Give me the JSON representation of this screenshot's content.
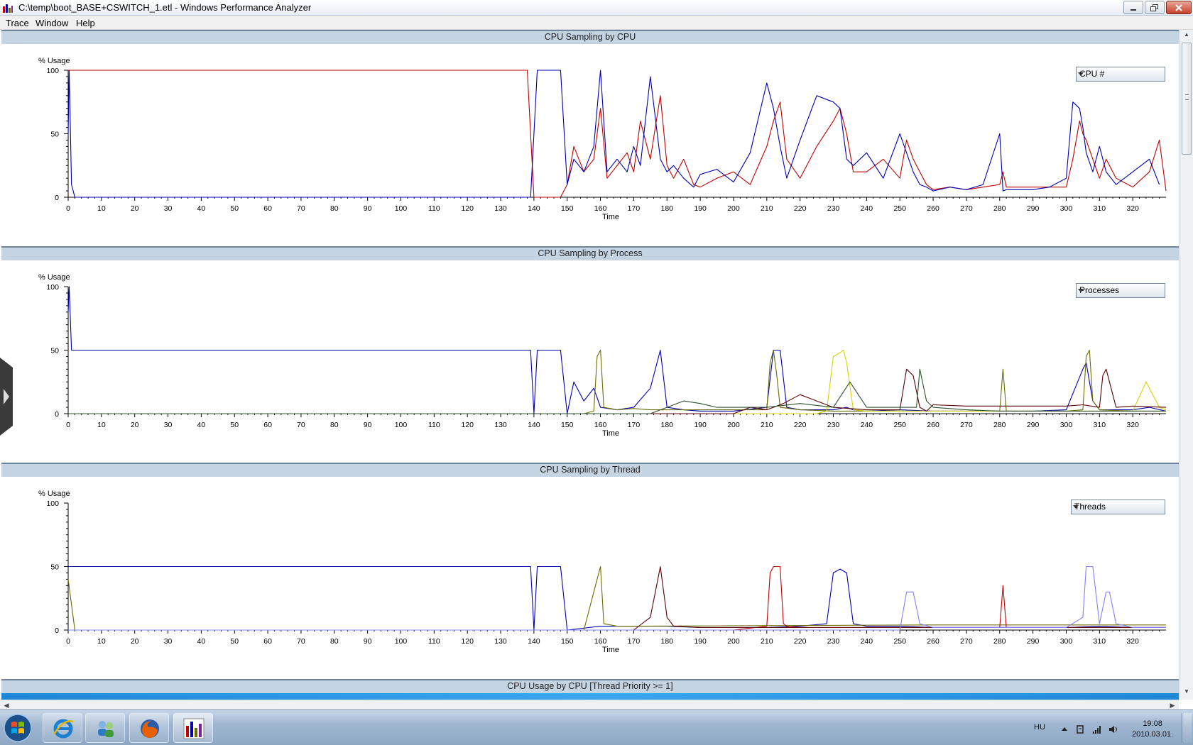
{
  "window": {
    "title": "C:\\temp\\boot_BASE+CSWITCH_1.etl - Windows Performance Analyzer"
  },
  "menu": [
    "Trace",
    "Window",
    "Help"
  ],
  "panels": [
    {
      "title": "CPU Sampling by CPU",
      "dropdown": "CPU #",
      "chart_data": {
        "type": "line",
        "ylabel": "% Usage",
        "xlabel": "Time",
        "ylim": [
          0,
          100
        ],
        "xlim": [
          0,
          330
        ],
        "yticks": [
          "100",
          "50",
          "0"
        ],
        "xticks": [
          "0",
          "10",
          "20",
          "30",
          "40",
          "50",
          "60",
          "70",
          "80",
          "90",
          "100",
          "110",
          "120",
          "130",
          "140",
          "150",
          "160",
          "170",
          "180",
          "190",
          "200",
          "210",
          "220",
          "230",
          "240",
          "250",
          "260",
          "270",
          "280",
          "290",
          "300",
          "310",
          "320"
        ],
        "colors": [
          "#c00000",
          "#0000b0"
        ],
        "series": [
          {
            "x": [
              0,
              0.3,
              1,
              138,
              139,
              140,
              141,
              148,
              150,
              152,
              155,
              158,
              160,
              162,
              165,
              168,
              170,
              172,
              175,
              178,
              180,
              182,
              185,
              188,
              190,
              195,
              200,
              205,
              210,
              212,
              214,
              216,
              220,
              225,
              230,
              232,
              234,
              236,
              240,
              245,
              250,
              252,
              254,
              256,
              258,
              260,
              265,
              270,
              275,
              280,
              281,
              282,
              285,
              290,
              295,
              300,
              302,
              304,
              305,
              306,
              308,
              310,
              312,
              315,
              320,
              325,
              328,
              330
            ],
            "y": [
              100,
              100,
              100,
              100,
              50,
              0,
              0,
              0,
              10,
              40,
              20,
              30,
              70,
              15,
              25,
              35,
              20,
              60,
              30,
              80,
              25,
              15,
              30,
              10,
              8,
              15,
              20,
              10,
              40,
              60,
              75,
              30,
              15,
              40,
              60,
              70,
              50,
              20,
              20,
              30,
              15,
              45,
              30,
              20,
              10,
              6,
              8,
              6,
              8,
              10,
              20,
              8,
              8,
              8,
              8,
              8,
              30,
              60,
              50,
              45,
              30,
              15,
              30,
              15,
              8,
              20,
              45,
              5
            ]
          },
          {
            "x": [
              0,
              0.3,
              1,
              2,
              139,
              140,
              141,
              142,
              148,
              150,
              152,
              155,
              158,
              160,
              162,
              165,
              168,
              170,
              172,
              175,
              178,
              180,
              182,
              185,
              188,
              190,
              195,
              200,
              205,
              210,
              212,
              214,
              216,
              220,
              225,
              230,
              232,
              234,
              236,
              240,
              245,
              250,
              252,
              254,
              256,
              258,
              260,
              265,
              270,
              275,
              280,
              281,
              282,
              285,
              290,
              295,
              300,
              302,
              304,
              305,
              306,
              308,
              310,
              312,
              315,
              320,
              325,
              328,
              330
            ],
            "y": [
              50,
              100,
              10,
              0,
              0,
              50,
              100,
              100,
              100,
              10,
              30,
              20,
              40,
              100,
              20,
              30,
              20,
              40,
              25,
              95,
              30,
              20,
              25,
              15,
              8,
              18,
              22,
              12,
              35,
              90,
              70,
              40,
              15,
              45,
              80,
              75,
              70,
              30,
              25,
              35,
              15,
              50,
              35,
              20,
              10,
              8,
              5,
              8,
              6,
              10,
              50,
              5,
              6,
              6,
              6,
              8,
              15,
              75,
              70,
              55,
              35,
              20,
              40,
              20,
              10,
              20,
              30,
              10
            ]
          }
        ]
      }
    },
    {
      "title": "CPU Sampling by Process",
      "dropdown": "Processes",
      "chart_data": {
        "type": "line",
        "ylabel": "% Usage",
        "xlabel": "Time",
        "ylim": [
          0,
          100
        ],
        "xlim": [
          0,
          330
        ],
        "yticks": [
          "100",
          "50",
          "0"
        ],
        "xticks": [
          "0",
          "10",
          "20",
          "30",
          "40",
          "50",
          "60",
          "70",
          "80",
          "90",
          "100",
          "110",
          "120",
          "130",
          "140",
          "150",
          "160",
          "170",
          "180",
          "190",
          "200",
          "210",
          "220",
          "230",
          "240",
          "250",
          "260",
          "270",
          "280",
          "290",
          "300",
          "310",
          "320"
        ],
        "colors": [
          "#0000b0",
          "#6b6b00",
          "#d4d400",
          "#5a0000",
          "#2f4f2f",
          "#8080ff",
          "#c00000"
        ],
        "series": [
          {
            "x": [
              0,
              0.3,
              1,
              2,
              139,
              140,
              141,
              142,
              148,
              150,
              152,
              155,
              158,
              160,
              165,
              170,
              175,
              178,
              180,
              185,
              190,
              200,
              210,
              212,
              214,
              216,
              220,
              230,
              232,
              234,
              236,
              240,
              250,
              260,
              270,
              280,
              290,
              300,
              305,
              306,
              308,
              310,
              320,
              325,
              330
            ],
            "y": [
              80,
              100,
              50,
              50,
              50,
              0,
              50,
              50,
              50,
              0,
              25,
              10,
              20,
              5,
              3,
              5,
              20,
              50,
              5,
              3,
              2,
              2,
              5,
              50,
              50,
              5,
              3,
              3,
              4,
              5,
              3,
              2,
              3,
              2,
              2,
              2,
              2,
              3,
              35,
              40,
              10,
              3,
              3,
              5,
              2
            ]
          },
          {
            "x": [
              0,
              155,
              158,
              159,
              160,
              161,
              165,
              170,
              175,
              210,
              211,
              212,
              213,
              214,
              220,
              230,
              240,
              250,
              260,
              270,
              280,
              281,
              282,
              290,
              300,
              305,
              306,
              307,
              308,
              310,
              320,
              330
            ],
            "y": [
              0,
              0,
              2,
              45,
              50,
              5,
              3,
              4,
              3,
              3,
              40,
              50,
              30,
              5,
              3,
              2,
              2,
              2,
              2,
              2,
              2,
              35,
              2,
              2,
              2,
              3,
              45,
              50,
              10,
              3,
              2,
              2
            ]
          },
          {
            "x": [
              0,
              225,
              228,
              230,
              232,
              233,
              234,
              236,
              240,
              320,
              324,
              326,
              328,
              330
            ],
            "y": [
              0,
              0,
              2,
              45,
              48,
              50,
              40,
              3,
              2,
              2,
              25,
              15,
              5,
              3
            ]
          },
          {
            "x": [
              0,
              200,
              205,
              210,
              215,
              220,
              230,
              240,
              250,
              252,
              254,
              256,
              258,
              260,
              270,
              280,
              290,
              300,
              305,
              310,
              311,
              312,
              313,
              315,
              320,
              330
            ],
            "y": [
              0,
              0,
              5,
              3,
              8,
              15,
              5,
              3,
              3,
              35,
              30,
              5,
              2,
              7,
              6,
              6,
              6,
              6,
              7,
              5,
              30,
              35,
              25,
              5,
              6,
              5
            ]
          },
          {
            "x": [
              0,
              175,
              180,
              185,
              190,
              195,
              200,
              210,
              220,
              230,
              235,
              240,
              250,
              255,
              256,
              258,
              260,
              270,
              280,
              300,
              330
            ],
            "y": [
              0,
              0,
              5,
              10,
              8,
              5,
              5,
              5,
              8,
              5,
              25,
              5,
              5,
              5,
              35,
              10,
              5,
              3,
              2,
              2,
              2
            ]
          }
        ]
      }
    },
    {
      "title": "CPU Sampling by Thread",
      "dropdown": "Threads",
      "chart_data": {
        "type": "line",
        "ylabel": "% Usage",
        "xlabel": "Time",
        "ylim": [
          0,
          100
        ],
        "xlim": [
          0,
          330
        ],
        "yticks": [
          "100",
          "50",
          "0"
        ],
        "xticks": [
          "0",
          "10",
          "20",
          "30",
          "40",
          "50",
          "60",
          "70",
          "80",
          "90",
          "100",
          "110",
          "120",
          "130",
          "140",
          "150",
          "160",
          "170",
          "180",
          "190",
          "200",
          "210",
          "220",
          "230",
          "240",
          "250",
          "260",
          "270",
          "280",
          "290",
          "300",
          "310",
          "320"
        ],
        "colors": [
          "#0000b0",
          "#6b6b00",
          "#c00000",
          "#5a0000",
          "#8080ff",
          "#d4d400",
          "#2f4f2f"
        ],
        "series": [
          {
            "x": [
              0,
              0.3,
              1,
              139,
              140,
              141,
              142,
              148,
              150,
              160,
              170,
              180,
              190,
              200,
              210,
              220,
              228,
              230,
              232,
              234,
              236,
              240,
              250,
              260,
              270,
              280,
              290,
              300,
              310,
              320,
              330
            ],
            "y": [
              50,
              50,
              50,
              50,
              0,
              50,
              50,
              50,
              0,
              3,
              3,
              3,
              2,
              2,
              2,
              3,
              5,
              45,
              48,
              45,
              5,
              3,
              3,
              2,
              2,
              2,
              2,
              2,
              3,
              2,
              2
            ]
          },
          {
            "x": [
              0,
              1,
              2,
              155,
              158,
              160,
              161,
              165,
              260,
              330
            ],
            "y": [
              40,
              20,
              0,
              0,
              30,
              50,
              5,
              3,
              4,
              4
            ]
          },
          {
            "x": [
              0,
              200,
              210,
              211,
              212,
              214,
              215,
              216,
              220,
              230,
              240,
              280,
              281,
              282,
              290,
              330
            ],
            "y": [
              0,
              0,
              3,
              45,
              50,
              50,
              5,
              3,
              2,
              2,
              2,
              2,
              35,
              2,
              2,
              2
            ]
          },
          {
            "x": [
              0,
              170,
              175,
              178,
              180,
              182,
              190,
              200,
              330
            ],
            "y": [
              0,
              0,
              10,
              50,
              10,
              3,
              2,
              2,
              2
            ]
          },
          {
            "x": [
              0,
              250,
              252,
              254,
              256,
              260,
              300,
              305,
              306,
              308,
              310,
              312,
              313,
              315,
              320,
              330
            ],
            "y": [
              0,
              0,
              30,
              30,
              5,
              2,
              2,
              10,
              50,
              50,
              5,
              30,
              30,
              5,
              2,
              2
            ]
          }
        ]
      }
    }
  ],
  "bottom_panel": {
    "title": "CPU Usage by CPU [Thread Priority >= 1]"
  },
  "taskbar": {
    "language": "HU",
    "time": "19:08",
    "date": "2010.03.01."
  }
}
